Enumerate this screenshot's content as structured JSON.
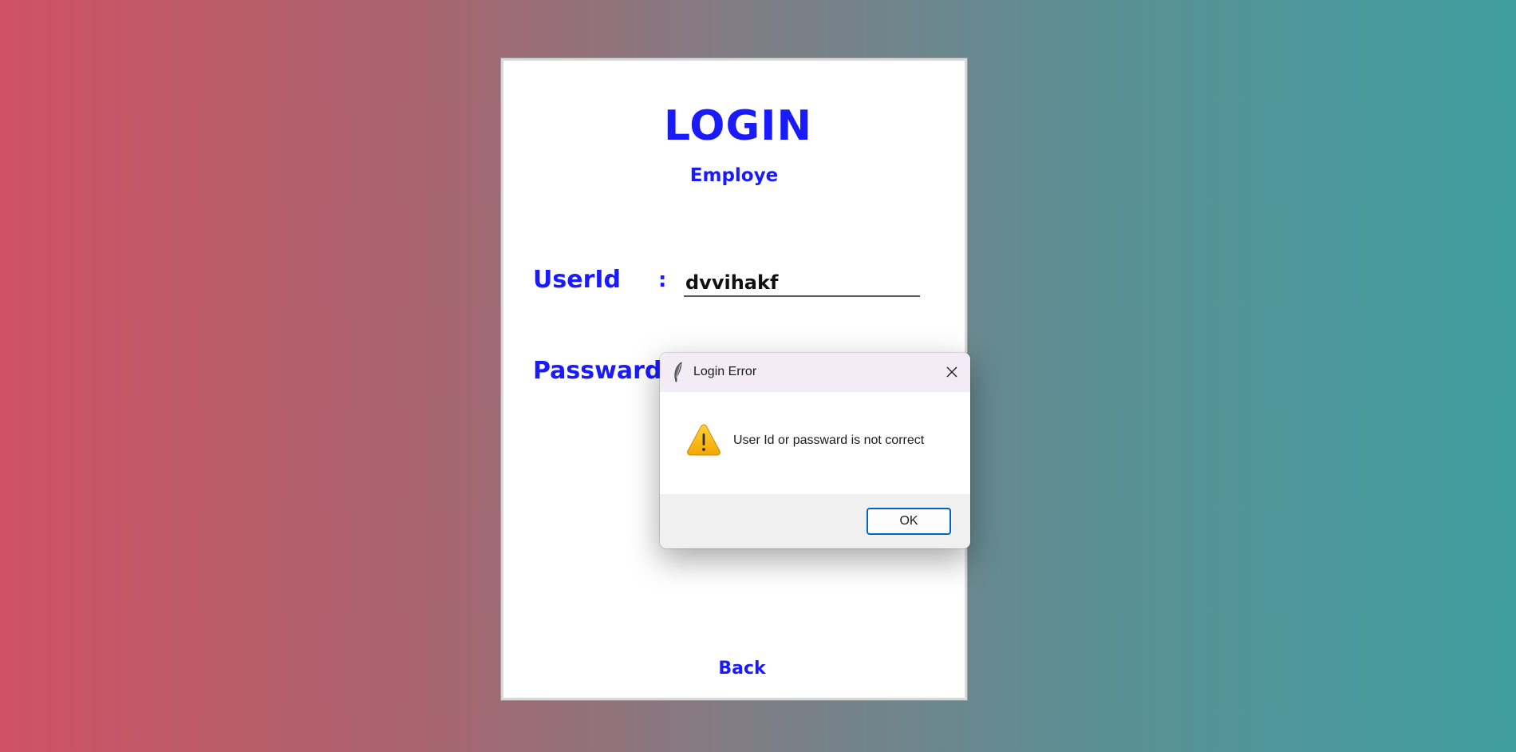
{
  "login_window": {
    "title": "LOGIN",
    "subtitle": "Employe",
    "userid_label": "UserId",
    "colon": ":",
    "userid_value": "dvvihakf",
    "password_label": "Passward",
    "back_label": "Back"
  },
  "dialog": {
    "title": "Login Error",
    "message": "User Id or passward is not correct",
    "ok_label": "OK",
    "icons": {
      "title_icon": "feather-icon",
      "close_icon": "close-icon",
      "message_icon": "warning-icon"
    }
  },
  "colors": {
    "label_blue": "#1a1aff",
    "ok_border": "#0067c0",
    "warning_yellow": "#f7b500"
  }
}
